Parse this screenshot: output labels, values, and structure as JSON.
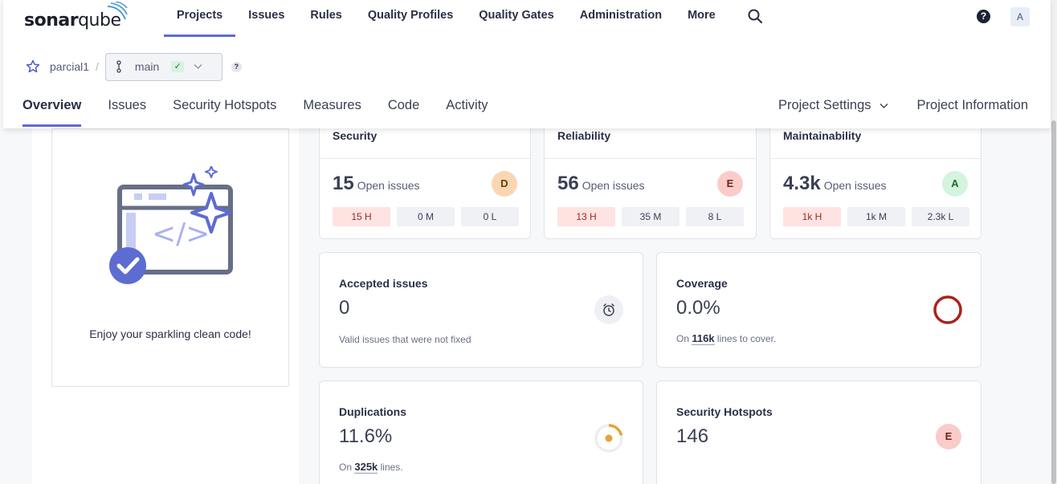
{
  "brand": {
    "logo_bold": "sonar",
    "logo_light": "qube"
  },
  "main_nav": [
    {
      "label": "Projects"
    },
    {
      "label": "Issues"
    },
    {
      "label": "Rules"
    },
    {
      "label": "Quality Profiles"
    },
    {
      "label": "Quality Gates"
    },
    {
      "label": "Administration"
    },
    {
      "label": "More"
    }
  ],
  "header": {
    "help": "?",
    "avatar": "A"
  },
  "breadcrumb": {
    "project": "parcial1",
    "separator": "/",
    "branch": "main",
    "branch_status": "✓",
    "help": "?"
  },
  "project_nav": [
    {
      "label": "Overview"
    },
    {
      "label": "Issues"
    },
    {
      "label": "Security Hotspots"
    },
    {
      "label": "Measures"
    },
    {
      "label": "Code"
    },
    {
      "label": "Activity"
    }
  ],
  "project_nav_right": {
    "settings": "Project Settings",
    "information": "Project Information"
  },
  "clean_code": {
    "message": "Enjoy your sparkling clean code!"
  },
  "ratings": [
    {
      "title": "Security",
      "value": "15",
      "label": "Open issues",
      "grade": "D",
      "high": "15 H",
      "medium": "0 M",
      "low": "0 L"
    },
    {
      "title": "Reliability",
      "value": "56",
      "label": "Open issues",
      "grade": "E",
      "high": "13 H",
      "medium": "35 M",
      "low": "8 L"
    },
    {
      "title": "Maintainability",
      "value": "4.3k",
      "label": "Open issues",
      "grade": "A",
      "high": "1k H",
      "medium": "1k M",
      "low": "2.3k L"
    }
  ],
  "accepted": {
    "title": "Accepted issues",
    "value": "0",
    "note": "Valid issues that were not fixed"
  },
  "coverage": {
    "title": "Coverage",
    "value": "0.0%",
    "note_prefix": "On",
    "lines": "116k",
    "note_suffix": "lines to cover."
  },
  "duplications": {
    "title": "Duplications",
    "value": "11.6%",
    "note_prefix": "On",
    "lines": "325k",
    "note_suffix": "lines."
  },
  "hotspots": {
    "title": "Security Hotspots",
    "value": "146",
    "grade": "E"
  },
  "colors": {
    "accent": "#5d6cd0",
    "coverage_ring": "#a7231c",
    "duplication_ring": "#e8a33a"
  }
}
